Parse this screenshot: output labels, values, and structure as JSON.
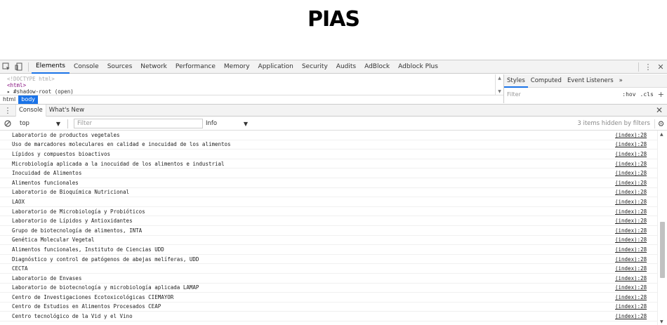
{
  "page": {
    "title": "PIAS"
  },
  "devtools": {
    "main_tabs": [
      "Elements",
      "Console",
      "Sources",
      "Network",
      "Performance",
      "Memory",
      "Application",
      "Security",
      "Audits",
      "AdBlock",
      "Adblock Plus"
    ],
    "selected_tab": "Elements",
    "menu_icon": "⋮",
    "close_icon": "✕",
    "dom_lines": [
      {
        "text": "<!DOCTYPE html>",
        "kind": "doctype"
      },
      {
        "text": "<html>",
        "kind": "tag"
      },
      {
        "text": "▸ #shadow-root (open)",
        "kind": "shadow"
      }
    ],
    "breadcrumbs": [
      "html",
      "body"
    ],
    "styles_tabs": [
      "Styles",
      "Computed",
      "Event Listeners",
      "»"
    ],
    "styles_filter_placeholder": "Filter",
    "styles_hov": ":hov",
    "styles_cls": ".cls",
    "styles_plus": "+"
  },
  "drawer": {
    "tabs": [
      "Console",
      "What's New"
    ],
    "selected_tab": "Console",
    "context": "top",
    "filter_placeholder": "Filter",
    "level": "Info",
    "hidden_count": "3 items hidden by filters"
  },
  "console": {
    "messages": [
      {
        "text": "Laboratorio de productos vegetales",
        "source": "(index):28"
      },
      {
        "text": "Uso de marcadores moleculares en calidad e inocuidad de los alimentos",
        "source": "(index):28"
      },
      {
        "text": "Lípidos y compuestos bioactivos",
        "source": "(index):28"
      },
      {
        "text": "Microbiología aplicada a la inocuidad de los alimentos e industrial",
        "source": "(index):28"
      },
      {
        "text": "Inocuidad de Alimentos",
        "source": "(index):28"
      },
      {
        "text": "Alimentos funcionales",
        "source": "(index):28"
      },
      {
        "text": "Laboratorio de Bioquímica Nutricional",
        "source": "(index):28"
      },
      {
        "text": "LAOX",
        "source": "(index):28"
      },
      {
        "text": "Laboratorio de Microbiología y Probióticos",
        "source": "(index):28"
      },
      {
        "text": "Laboratorio de Lípidos y Antioxidantes",
        "source": "(index):28"
      },
      {
        "text": "Grupo de biotecnología de alimentos, INTA",
        "source": "(index):28"
      },
      {
        "text": "Genética Molecular Vegetal",
        "source": "(index):28"
      },
      {
        "text": "Alimentos funcionales, Instituto de Ciencias UDD",
        "source": "(index):28"
      },
      {
        "text": "Diagnóstico y control de patógenos de abejas melíferas, UDD",
        "source": "(index):28"
      },
      {
        "text": "CECTA",
        "source": "(index):28"
      },
      {
        "text": "Laboratorio de Envases",
        "source": "(index):28"
      },
      {
        "text": "Laboratorio de biotecnología y microbiología aplicada LAMAP",
        "source": "(index):28"
      },
      {
        "text": "Centro de Investigaciones Ecotoxicológicas CIEMAYOR",
        "source": "(index):28"
      },
      {
        "text": "Centro de Estudios en Alimentos Procesados CEAP",
        "source": "(index):28"
      },
      {
        "text": "Centro tecnológico de la Vid y el Vino",
        "source": "(index):28"
      }
    ]
  }
}
